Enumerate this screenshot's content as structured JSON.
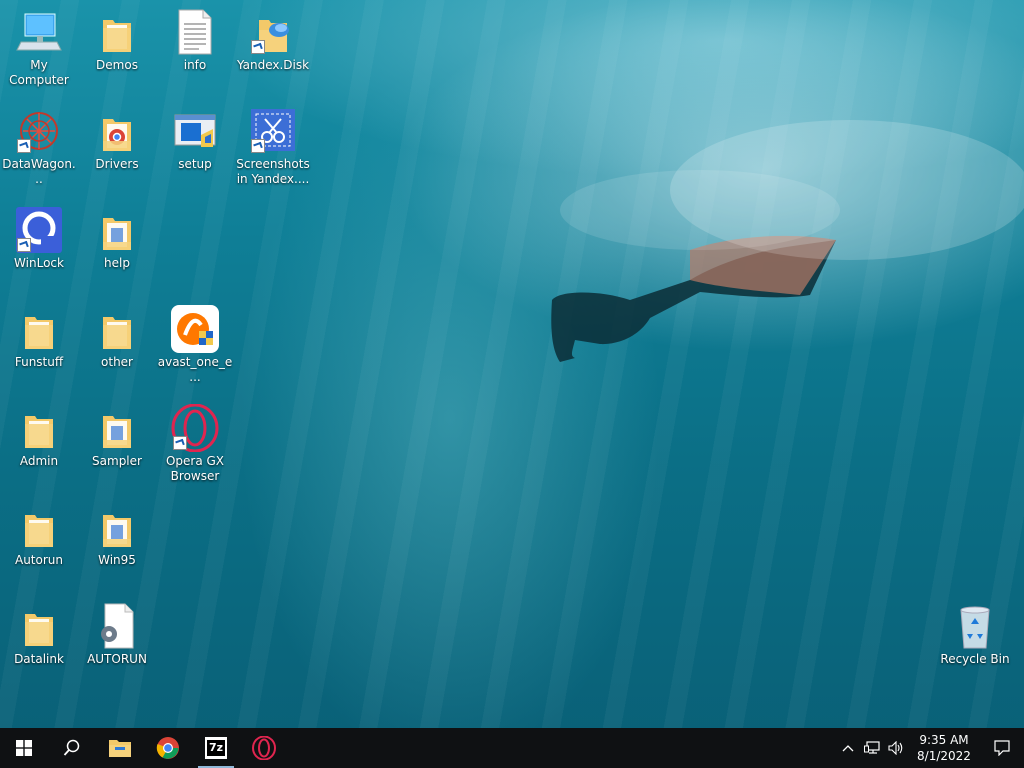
{
  "desktop": {
    "icons": [
      {
        "label": "My Computer"
      },
      {
        "label": "Demos"
      },
      {
        "label": "info"
      },
      {
        "label": "Yandex.Disk"
      },
      {
        "label": "DataWagon..."
      },
      {
        "label": "Drivers"
      },
      {
        "label": "setup"
      },
      {
        "label": "Screenshots in Yandex...."
      },
      {
        "label": "WinLock"
      },
      {
        "label": "help"
      },
      {
        "label": "Funstuff"
      },
      {
        "label": "other"
      },
      {
        "label": "avast_one_e..."
      },
      {
        "label": "Admin"
      },
      {
        "label": "Sampler"
      },
      {
        "label": "Opera GX Browser"
      },
      {
        "label": "Autorun"
      },
      {
        "label": "Win95"
      },
      {
        "label": "Datalink"
      },
      {
        "label": "AUTORUN"
      },
      {
        "label": "Recycle Bin"
      }
    ]
  },
  "taskbar": {
    "apps": [
      {
        "name": "start-icon"
      },
      {
        "name": "search-icon"
      },
      {
        "name": "file-explorer-icon"
      },
      {
        "name": "chrome-icon"
      },
      {
        "name": "7zip-icon",
        "text": "7z"
      },
      {
        "name": "opera-gx-icon"
      }
    ],
    "tray": {
      "time": "9:35 AM",
      "date": "8/1/2022"
    }
  },
  "colors": {
    "taskbar": "#0f1113",
    "folder": "#f3c969",
    "water": "#0f7f97"
  }
}
